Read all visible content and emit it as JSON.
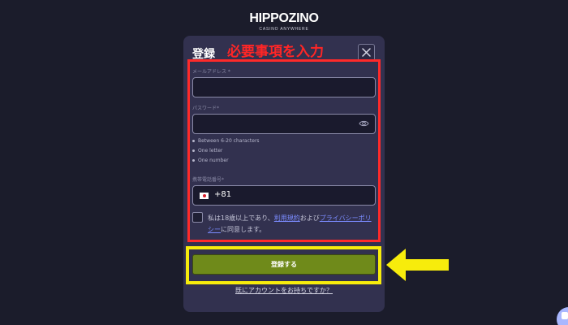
{
  "brand": {
    "name": "HIPPOZINO",
    "tagline": "CASINO ANYWHERE"
  },
  "modal": {
    "title": "登録",
    "annotation_text": "必要事項を入力",
    "close_icon": "close-icon"
  },
  "form": {
    "email_label": "メールアドレス *",
    "email_value": "",
    "password_label": "パスワード*",
    "password_value": "",
    "password_hints": [
      "Between 6-20 characters",
      "One letter",
      "One number"
    ],
    "phone_label": "携帯電話番号*",
    "phone_code": "+81",
    "consent_prefix": "私は18歳以上であり、",
    "terms_link": "利用規約",
    "consent_mid": "および",
    "privacy_link": "プライバシーポリシー",
    "consent_suffix": "に同意します。",
    "submit_label": "登録する",
    "login_link": "既にアカウントをお持ちですか？"
  },
  "colors": {
    "background": "#1b1c2b",
    "modal": "#32314f",
    "annotation_red": "#ff2a2a",
    "annotation_yellow": "#f7ec0c",
    "submit_green": "#6f8a1a",
    "link_blue": "#7b8cff"
  }
}
